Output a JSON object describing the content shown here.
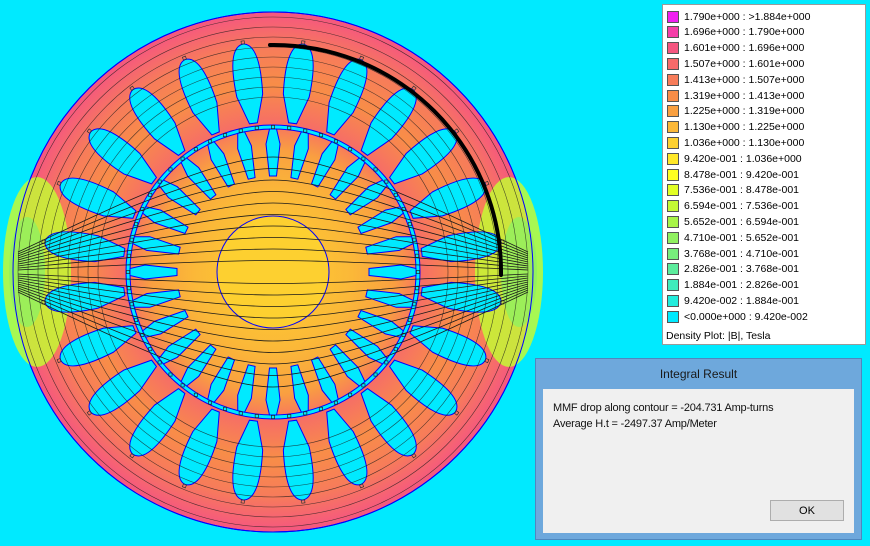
{
  "colors": {
    "background": "#00eaff",
    "outline": "#0000ff",
    "flux_line": "#1a1a1a",
    "contour": "#000000",
    "dialog_frame": "#6ea8dc"
  },
  "legend": {
    "rows": [
      {
        "label": "1.790e+000 : >1.884e+000",
        "color": "#f020f0"
      },
      {
        "label": "1.696e+000 : 1.790e+000",
        "color": "#f43ea8"
      },
      {
        "label": "1.601e+000 : 1.696e+000",
        "color": "#f55680"
      },
      {
        "label": "1.507e+000 : 1.601e+000",
        "color": "#f66a6a"
      },
      {
        "label": "1.413e+000 : 1.507e+000",
        "color": "#f77c5a"
      },
      {
        "label": "1.319e+000 : 1.413e+000",
        "color": "#f88d48"
      },
      {
        "label": "1.225e+000 : 1.319e+000",
        "color": "#f9a040"
      },
      {
        "label": "1.130e+000 : 1.225e+000",
        "color": "#fbb838"
      },
      {
        "label": "1.036e+000 : 1.130e+000",
        "color": "#fdd030"
      },
      {
        "label": "9.420e-001 : 1.036e+000",
        "color": "#ffe828"
      },
      {
        "label": "8.478e-001 : 9.420e-001",
        "color": "#ffff20"
      },
      {
        "label": "7.536e-001 : 8.478e-001",
        "color": "#e2ff24"
      },
      {
        "label": "6.594e-001 : 7.536e-001",
        "color": "#c4fa34"
      },
      {
        "label": "5.652e-001 : 6.594e-001",
        "color": "#a8f448"
      },
      {
        "label": "4.710e-001 : 5.652e-001",
        "color": "#90f060"
      },
      {
        "label": "3.768e-001 : 4.710e-001",
        "color": "#78ee7c"
      },
      {
        "label": "2.826e-001 : 3.768e-001",
        "color": "#5cec9c"
      },
      {
        "label": "1.884e-001 : 2.826e-001",
        "color": "#40ecbc"
      },
      {
        "label": "9.420e-002 : 1.884e-001",
        "color": "#22ecdc"
      },
      {
        "label": "<0.000e+000 : 9.420e-002",
        "color": "#00eaff"
      }
    ],
    "caption": "Density Plot: |B|, Tesla"
  },
  "dialog": {
    "title": "Integral Result",
    "line1": "MMF drop along contour = -204.731 Amp-turns",
    "line2": "Average H.t = -2497.37 Amp/Meter",
    "ok_label": "OK"
  }
}
